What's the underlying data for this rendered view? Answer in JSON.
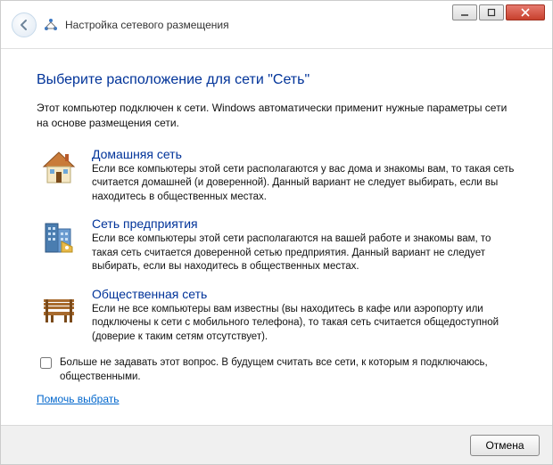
{
  "header": {
    "title": "Настройка сетевого размещения"
  },
  "heading": "Выберите расположение для сети \"Сеть\"",
  "intro": "Этот компьютер подключен к сети. Windows автоматически применит нужные параметры сети на основе размещения сети.",
  "options": {
    "home": {
      "title": "Домашняя сеть",
      "desc": "Если все компьютеры этой сети располагаются у вас дома и знакомы вам, то такая сеть считается домашней (и доверенной). Данный вариант не следует выбирать, если вы находитесь в общественных местах."
    },
    "work": {
      "title": "Сеть предприятия",
      "desc": "Если все компьютеры этой сети располагаются на вашей работе и знакомы вам, то такая сеть считается доверенной сетью предприятия. Данный вариант не следует выбирать, если вы находитесь в общественных местах."
    },
    "public": {
      "title": "Общественная сеть",
      "desc": "Если не все компьютеры вам известны (вы находитесь в кафе или аэропорту или подключены к сети с мобильного телефона), то такая сеть считается общедоступной (доверие к таким сетям отсутствует)."
    }
  },
  "checkbox_label": "Больше не задавать этот вопрос. В будущем считать все сети, к которым я подключаюсь, общественными.",
  "help_link": "Помочь выбрать",
  "footer": {
    "cancel": "Отмена"
  }
}
